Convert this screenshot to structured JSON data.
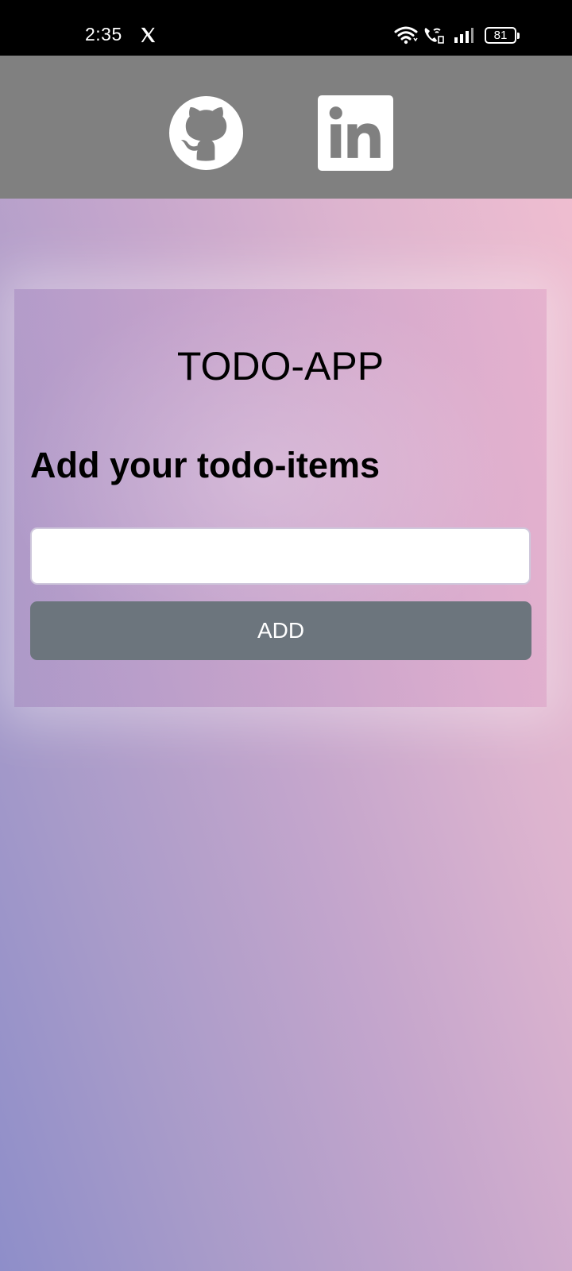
{
  "status_bar": {
    "time": "2:35",
    "notification_icon": "x-logo-icon",
    "battery_level": "81",
    "icons": [
      "wifi-icon",
      "wifi-call-icon",
      "signal-icon",
      "battery-icon"
    ]
  },
  "header": {
    "links": [
      {
        "name": "github",
        "icon": "github-icon"
      },
      {
        "name": "linkedin",
        "icon": "linkedin-icon",
        "glyph": "in"
      }
    ],
    "background": "#808080"
  },
  "main": {
    "title": "TODO-APP",
    "subtitle": "Add your todo-items",
    "input": {
      "value": "",
      "placeholder": ""
    },
    "add_button_label": "ADD",
    "button_color": "#6c757d"
  }
}
